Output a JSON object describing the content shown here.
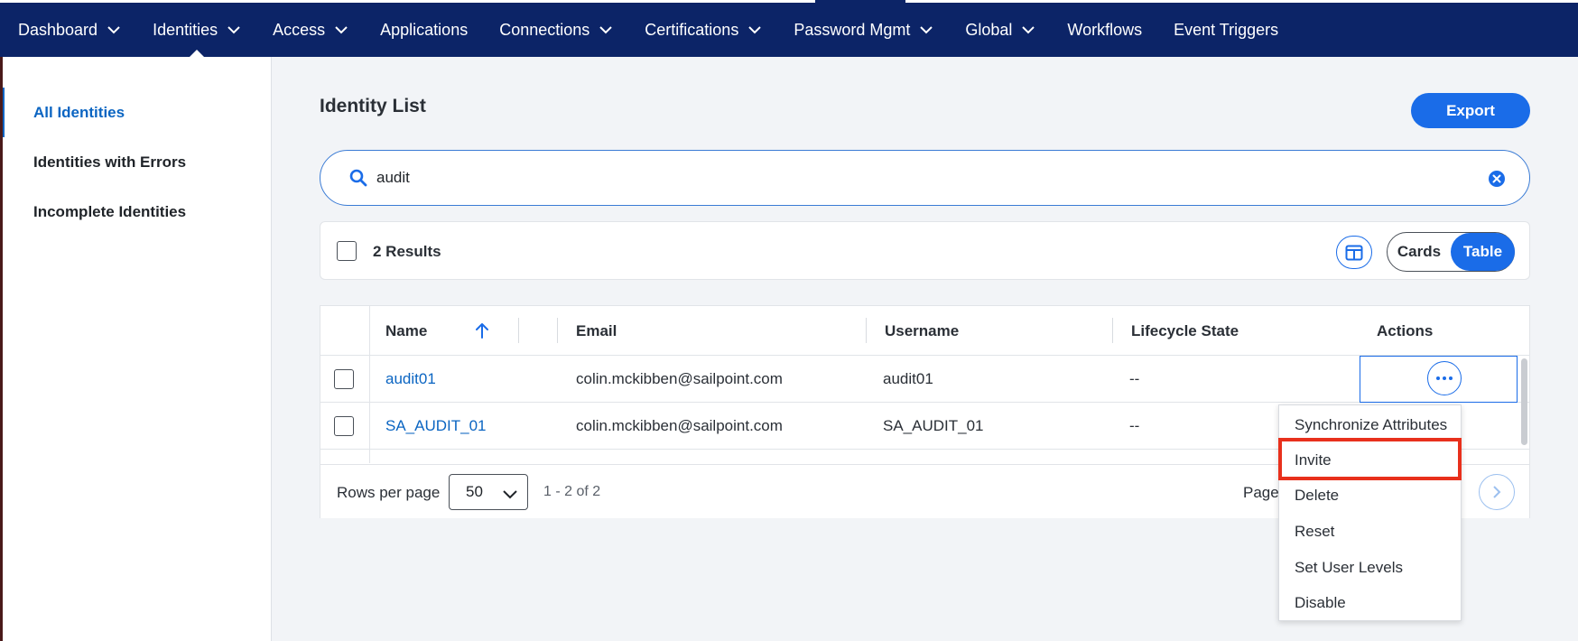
{
  "nav": {
    "items": [
      {
        "label": "Dashboard",
        "dropdown": true
      },
      {
        "label": "Identities",
        "dropdown": true,
        "active": true
      },
      {
        "label": "Access",
        "dropdown": true
      },
      {
        "label": "Applications",
        "dropdown": false
      },
      {
        "label": "Connections",
        "dropdown": true
      },
      {
        "label": "Certifications",
        "dropdown": true
      },
      {
        "label": "Password Mgmt",
        "dropdown": true
      },
      {
        "label": "Global",
        "dropdown": true
      },
      {
        "label": "Workflows",
        "dropdown": false
      },
      {
        "label": "Event Triggers",
        "dropdown": false
      }
    ]
  },
  "sidebar": {
    "items": [
      {
        "label": "All Identities",
        "active": true
      },
      {
        "label": "Identities with Errors"
      },
      {
        "label": "Incomplete Identities"
      }
    ]
  },
  "page": {
    "title": "Identity List",
    "export_label": "Export"
  },
  "search": {
    "value": "audit"
  },
  "results": {
    "label": "2 Results",
    "view_cards": "Cards",
    "view_table": "Table"
  },
  "table": {
    "headers": {
      "name": "Name",
      "email": "Email",
      "username": "Username",
      "lifecycle": "Lifecycle State",
      "actions": "Actions"
    },
    "rows": [
      {
        "name": "audit01",
        "email": "colin.mckibben@sailpoint.com",
        "username": "audit01",
        "lifecycle": "--"
      },
      {
        "name": "SA_AUDIT_01",
        "email": "colin.mckibben@sailpoint.com",
        "username": "SA_AUDIT_01",
        "lifecycle": "--"
      }
    ]
  },
  "pagination": {
    "rows_per_page_label": "Rows per page",
    "rows_per_page_value": "50",
    "range": "1 - 2 of 2",
    "page_label": "Page"
  },
  "actions_menu": {
    "items": [
      "Synchronize Attributes",
      "Invite",
      "Delete",
      "Reset",
      "Set User Levels",
      "Disable"
    ]
  },
  "colors": {
    "nav_bg": "#0c2467",
    "accent": "#1a6ce8",
    "link": "#0b65c2",
    "highlight": "#e8301c"
  }
}
